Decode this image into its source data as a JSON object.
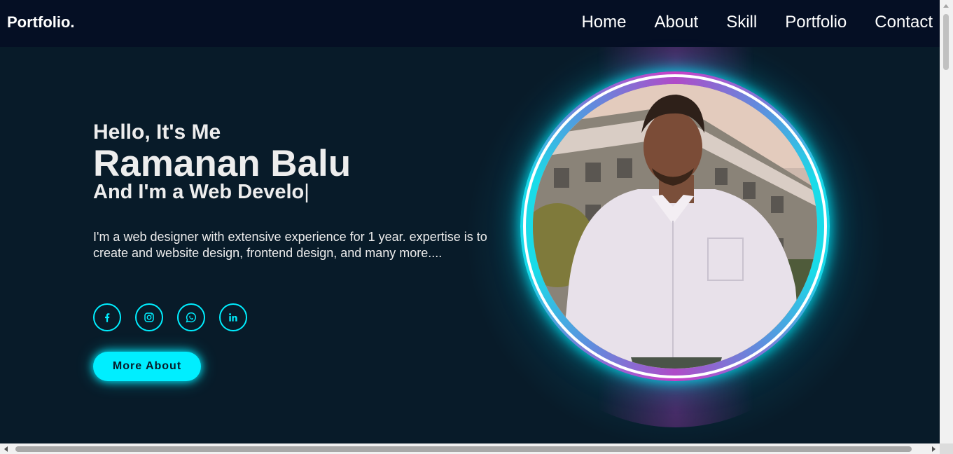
{
  "header": {
    "logo": "Portfolio.",
    "nav": [
      "Home",
      "About",
      "Skill",
      "Portfolio",
      "Contact"
    ]
  },
  "home": {
    "greeting": "Hello, It's Me",
    "name": "Ramanan Balu",
    "role_prefix": "And I'm a ",
    "role_typed": "Web Develo",
    "cursor": "|",
    "description": "I'm a web designer with extensive experience for 1 year. expertise is to create and website design, frontend design, and many more....",
    "social": [
      {
        "icon": "facebook-icon"
      },
      {
        "icon": "instagram-icon"
      },
      {
        "icon": "whatsapp-icon"
      },
      {
        "icon": "linkedin-icon"
      }
    ],
    "button_label": "More About"
  },
  "colors": {
    "accent": "#00eeff",
    "background": "#081b29",
    "header_bg": "#050f24",
    "text": "#ededed",
    "ring_magenta": "#c940c8"
  }
}
